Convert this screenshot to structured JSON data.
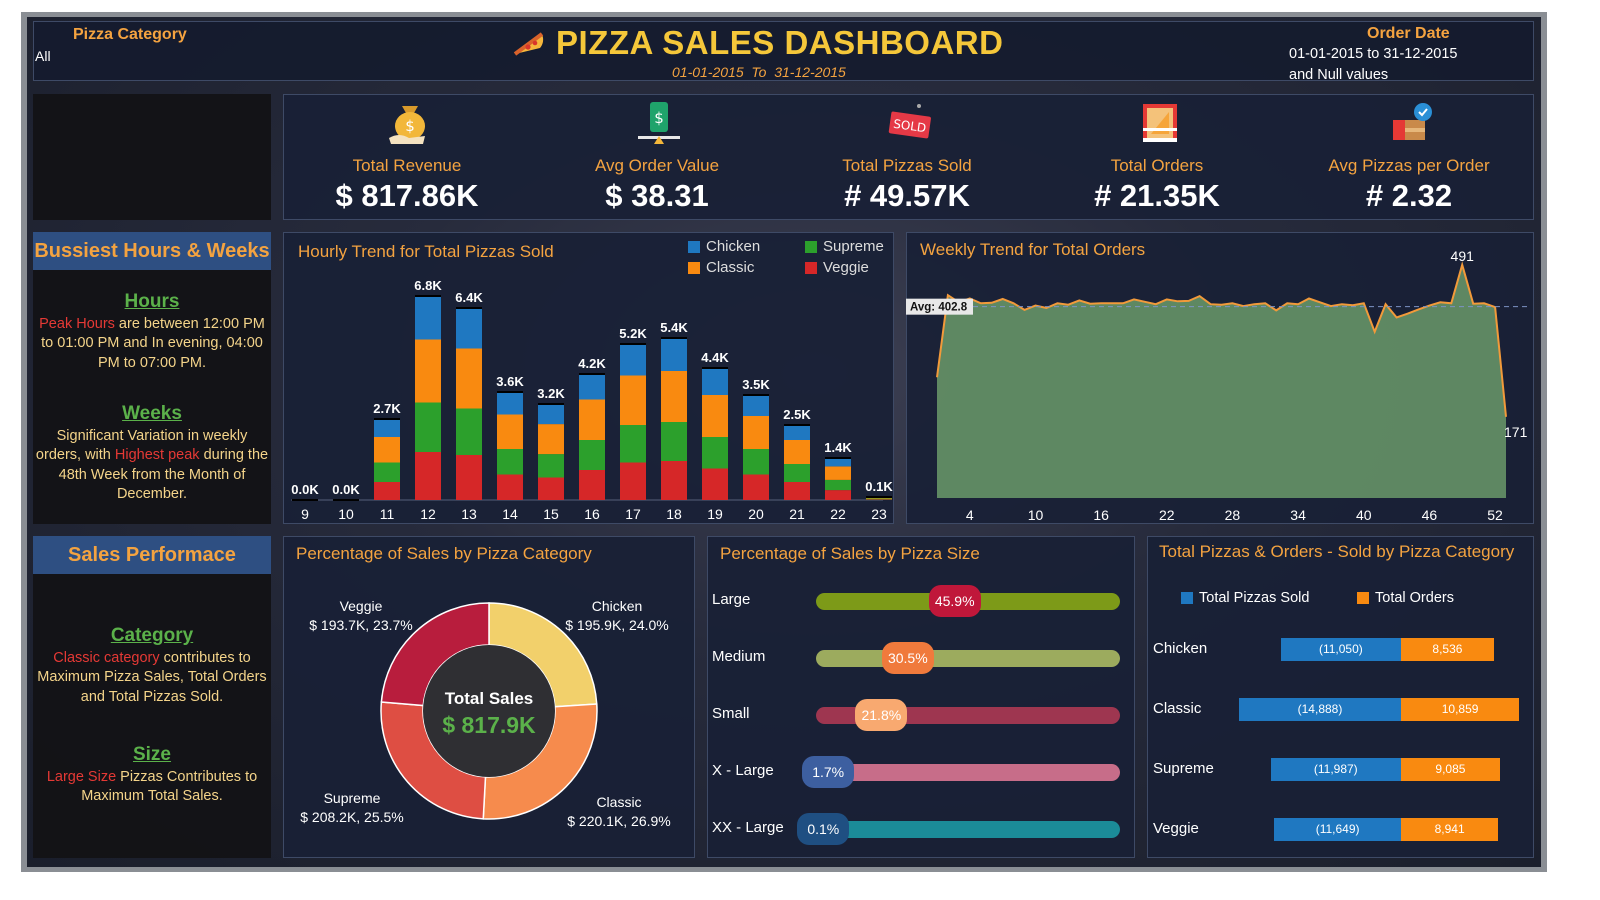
{
  "header": {
    "filter_label": "Pizza Category",
    "filter_value": "All",
    "title": "PIZZA SALES DASHBOARD",
    "subtitle": "01-01-2015  To  31-12-2015",
    "date_label": "Order Date",
    "date_value_1": "01-01-2015 to 31-12-2015",
    "date_value_2": "and Null values"
  },
  "kpis": [
    {
      "label": "Total Revenue",
      "value": "$ 817.86K",
      "icon": "money-bag-icon"
    },
    {
      "label": "Avg Order Value",
      "value": "$ 38.31",
      "icon": "dollar-balance-icon"
    },
    {
      "label": "Total Pizzas Sold",
      "value": "# 49.57K",
      "icon": "sold-tag-icon"
    },
    {
      "label": "Total Orders",
      "value": "# 21.35K",
      "icon": "pizza-box-icon"
    },
    {
      "label": "Avg Pizzas per Order",
      "value": "# 2.32",
      "icon": "delivery-box-icon"
    }
  ],
  "busiest": {
    "title": "Bussiest Hours & Weeks",
    "hours_heading": "Hours",
    "hours_red": "Peak Hours",
    "hours_text": " are between 12:00 PM to 01:00 PM and In evening, 04:00 PM to 07:00 PM.",
    "weeks_heading": "Weeks",
    "weeks_text_1": "Significant Variation in weekly orders, with ",
    "weeks_red": "Highest peak",
    "weeks_text_2": " during the 48th Week from the Month of December."
  },
  "sales_perf": {
    "title": "Sales Performace",
    "category_heading": "Category",
    "category_red": "Classic category",
    "category_text": " contributes to Maximum Pizza Sales, Total Orders and Total Pizzas Sold.",
    "size_heading": "Size",
    "size_red": "Large Size",
    "size_text": " Pizzas Contributes to Maximum Total Sales."
  },
  "colors": {
    "chicken": "#1f78c1",
    "classic": "#f98a10",
    "supreme": "#2ca02c",
    "veggie": "#d62728",
    "accent": "#f4a340"
  },
  "chart_data": [
    {
      "type": "bar",
      "title": "Hourly Trend for Total Pizzas Sold",
      "stacked": true,
      "categories": [
        "9",
        "10",
        "11",
        "12",
        "13",
        "14",
        "15",
        "16",
        "17",
        "18",
        "19",
        "20",
        "21",
        "22",
        "23"
      ],
      "totals_labels": [
        "0.0K",
        "0.0K",
        "2.7K",
        "6.8K",
        "6.4K",
        "3.6K",
        "3.2K",
        "4.2K",
        "5.2K",
        "5.4K",
        "4.4K",
        "3.5K",
        "2.5K",
        "1.4K",
        "0.1K"
      ],
      "totals": [
        0,
        0,
        2.7,
        6.8,
        6.4,
        3.6,
        3.2,
        4.2,
        5.2,
        5.4,
        4.4,
        3.5,
        2.5,
        1.4,
        0.1
      ],
      "legend_position": "top-right",
      "series": [
        {
          "name": "Veggie",
          "color": "#d62728",
          "values": [
            0,
            0,
            0.6,
            1.6,
            1.5,
            0.85,
            0.75,
            1.0,
            1.25,
            1.3,
            1.05,
            0.85,
            0.6,
            0.33,
            0.02
          ]
        },
        {
          "name": "Supreme",
          "color": "#2ca02c",
          "values": [
            0,
            0,
            0.65,
            1.65,
            1.55,
            0.85,
            0.78,
            1.0,
            1.25,
            1.3,
            1.05,
            0.85,
            0.6,
            0.34,
            0.03
          ]
        },
        {
          "name": "Classic",
          "color": "#f98a10",
          "values": [
            0,
            0,
            0.85,
            2.1,
            2.0,
            1.15,
            1.0,
            1.35,
            1.65,
            1.7,
            1.4,
            1.1,
            0.8,
            0.45,
            0.03
          ]
        },
        {
          "name": "Chicken",
          "color": "#1f78c1",
          "values": [
            0,
            0,
            0.6,
            1.45,
            1.35,
            0.75,
            0.67,
            0.85,
            1.05,
            1.1,
            0.9,
            0.7,
            0.5,
            0.28,
            0.02
          ]
        }
      ],
      "legend": [
        "Chicken",
        "Supreme",
        "Classic",
        "Veggie"
      ]
    },
    {
      "type": "area",
      "title": "Weekly Trend for Total Orders",
      "x_ticks": [
        "4",
        "10",
        "16",
        "22",
        "28",
        "34",
        "40",
        "46",
        "52"
      ],
      "x": [
        1,
        2,
        3,
        4,
        5,
        6,
        7,
        8,
        9,
        10,
        11,
        12,
        13,
        14,
        15,
        16,
        17,
        18,
        19,
        20,
        21,
        22,
        23,
        24,
        25,
        26,
        27,
        28,
        29,
        30,
        31,
        32,
        33,
        34,
        35,
        36,
        37,
        38,
        39,
        40,
        41,
        42,
        43,
        44,
        45,
        46,
        47,
        48,
        49,
        50,
        51,
        52,
        53
      ],
      "y": [
        254,
        427,
        412,
        420,
        410,
        411,
        419,
        410,
        396,
        405,
        400,
        410,
        407,
        416,
        409,
        410,
        410,
        410,
        418,
        413,
        408,
        418,
        414,
        415,
        425,
        408,
        407,
        410,
        404,
        408,
        410,
        395,
        410,
        408,
        420,
        412,
        404,
        408,
        406,
        410,
        350,
        408,
        380,
        388,
        397,
        405,
        412,
        410,
        491,
        409,
        410,
        402,
        171
      ],
      "average_label": "Avg: 402.8",
      "average": 402.8,
      "peak_label": "491",
      "end_label": "171",
      "ylim": [
        0,
        560
      ]
    },
    {
      "type": "pie",
      "title": "Percentage of Sales by Pizza Category",
      "center_label": "Total Sales",
      "center_value": "$ 817.9K",
      "slices": [
        {
          "name": "Chicken",
          "value": 24.0,
          "label": "$ 195.9K, 24.0%",
          "color": "#f2d06b"
        },
        {
          "name": "Classic",
          "value": 26.9,
          "label": "$ 220.1K, 26.9%",
          "color": "#f68b4d"
        },
        {
          "name": "Supreme",
          "value": 25.5,
          "label": "$ 208.2K, 25.5%",
          "color": "#de4e43"
        },
        {
          "name": "Veggie",
          "value": 23.7,
          "label": "$ 193.7K, 23.7%",
          "color": "#b81d3d"
        }
      ]
    },
    {
      "type": "bar",
      "title": "Percentage of Sales by Pizza Size",
      "categories": [
        "Large",
        "Medium",
        "Small",
        "X - Large",
        "XX - Large"
      ],
      "values": [
        45.9,
        30.5,
        21.8,
        1.7,
        0.1
      ],
      "labels": [
        "45.9%",
        "30.5%",
        "21.8%",
        "1.7%",
        "0.1%"
      ],
      "track_colors": [
        "#7d9a18",
        "#9cab5e",
        "#9e3650",
        "#c76d89",
        "#1b8b98"
      ],
      "pill_colors": [
        "#c0173a",
        "#f07a3c",
        "#f8a970",
        "#3d5fa0",
        "#1f4f82"
      ]
    },
    {
      "type": "bar",
      "title": "Total Pizzas & Orders - Sold by Pizza Category",
      "legend": [
        "Total Pizzas Sold",
        "Total Orders"
      ],
      "categories": [
        "Chicken",
        "Classic",
        "Supreme",
        "Veggie"
      ],
      "series": [
        {
          "name": "Total Pizzas Sold",
          "values": [
            11050,
            14888,
            11987,
            11649
          ],
          "labels": [
            "(11,050)",
            "(14,888)",
            "(11,987)",
            "(11,649)"
          ],
          "color": "#1f78c1"
        },
        {
          "name": "Total Orders",
          "values": [
            8536,
            10859,
            9085,
            8941
          ],
          "labels": [
            "8,536",
            "10,859",
            "9,085",
            "8,941"
          ],
          "color": "#f98a10"
        }
      ]
    }
  ]
}
